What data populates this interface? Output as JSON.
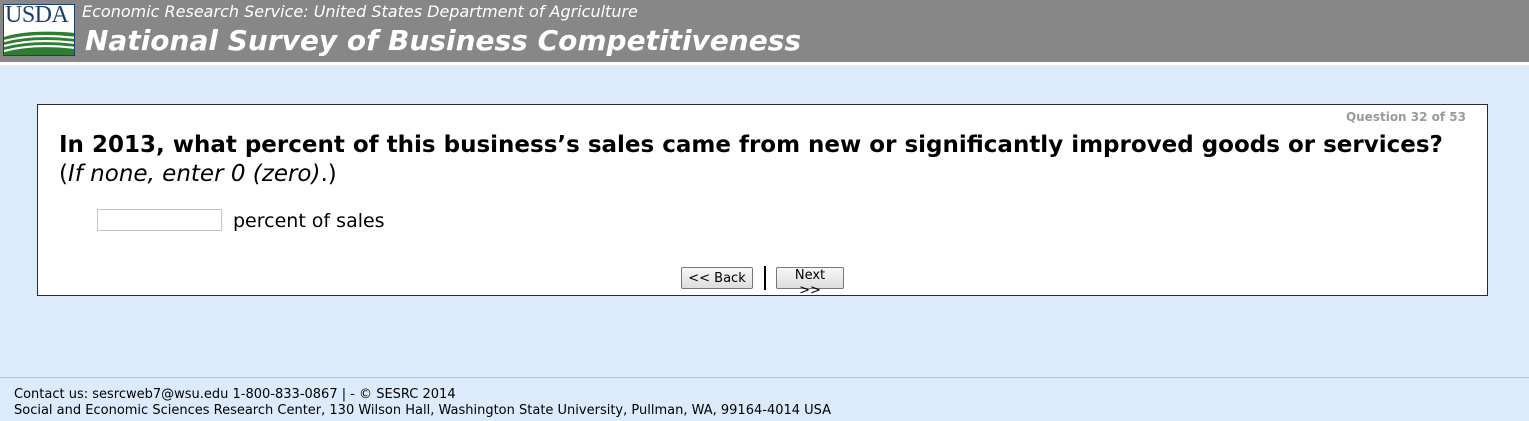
{
  "header": {
    "logo_text": "USDA",
    "agency": "Economic Research Service: United States Department of Agriculture",
    "title": "National Survey of Business Competitiveness"
  },
  "question": {
    "counter": "Question 32 of 53",
    "text_main": "In 2013, what percent of this business’s sales came from new or significantly improved goods or services?",
    "note_open": " (",
    "note_italic": "If none, enter 0 (zero)",
    "note_close": ".)",
    "answer_value": "",
    "answer_placeholder": "",
    "unit_label": "percent of sales"
  },
  "nav": {
    "back_label": "<< Back",
    "next_label": "Next >>"
  },
  "footer": {
    "contact": "Contact us: sesrcweb7@wsu.edu 1-800-833-0867 | - © SESRC 2014",
    "address": "Social and Economic Sciences Research Center, 130 Wilson Hall, Washington State University, Pullman, WA, 99164-4014 USA"
  },
  "colors": {
    "header_bg": "#878787",
    "page_bg": "#dcebfb",
    "logo_blue": "#1c3e6e",
    "logo_green": "#2e7d32"
  }
}
